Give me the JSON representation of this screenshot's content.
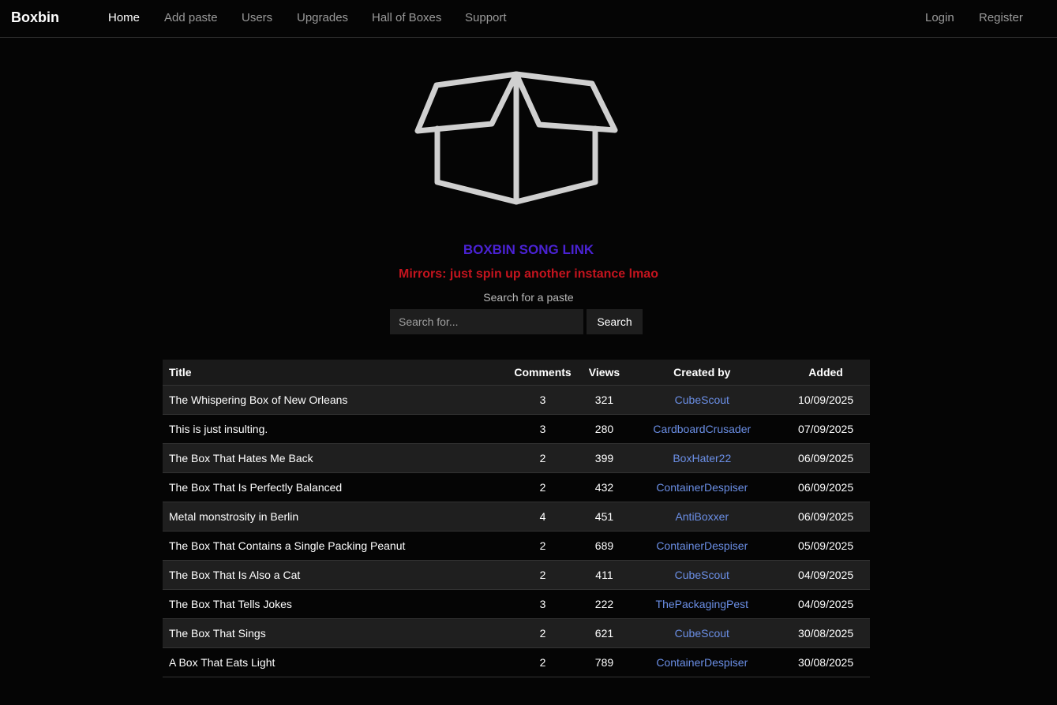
{
  "navbar": {
    "brand": "Boxbin",
    "links": [
      "Home",
      "Add paste",
      "Users",
      "Upgrades",
      "Hall of Boxes",
      "Support"
    ],
    "active": "Home",
    "login": "Login",
    "register": "Register"
  },
  "hero": {
    "logo_icon": "open-box-icon",
    "logo_color": "#d0d0d0",
    "song_link": "BOXBIN SONG LINK",
    "mirrors": "Mirrors: just spin up another instance lmao"
  },
  "search": {
    "label": "Search for a paste",
    "placeholder": "Search for...",
    "value": "",
    "button": "Search"
  },
  "table": {
    "headers": {
      "title": "Title",
      "comments": "Comments",
      "views": "Views",
      "created_by": "Created by",
      "added": "Added"
    },
    "rows": [
      {
        "title": "The Whispering Box of New Orleans",
        "comments": "3",
        "views": "321",
        "created_by": "CubeScout",
        "added": "10/09/2025"
      },
      {
        "title": "This is just insulting.",
        "comments": "3",
        "views": "280",
        "created_by": "CardboardCrusader",
        "added": "07/09/2025"
      },
      {
        "title": "The Box That Hates Me Back",
        "comments": "2",
        "views": "399",
        "created_by": "BoxHater22",
        "added": "06/09/2025"
      },
      {
        "title": "The Box That Is Perfectly Balanced",
        "comments": "2",
        "views": "432",
        "created_by": "ContainerDespiser",
        "added": "06/09/2025"
      },
      {
        "title": "Metal monstrosity in Berlin",
        "comments": "4",
        "views": "451",
        "created_by": "AntiBoxxer",
        "added": "06/09/2025"
      },
      {
        "title": "The Box That Contains a Single Packing Peanut",
        "comments": "2",
        "views": "689",
        "created_by": "ContainerDespiser",
        "added": "05/09/2025"
      },
      {
        "title": "The Box That Is Also a Cat",
        "comments": "2",
        "views": "411",
        "created_by": "CubeScout",
        "added": "04/09/2025"
      },
      {
        "title": "The Box That Tells Jokes",
        "comments": "3",
        "views": "222",
        "created_by": "ThePackagingPest",
        "added": "04/09/2025"
      },
      {
        "title": "The Box That Sings",
        "comments": "2",
        "views": "621",
        "created_by": "CubeScout",
        "added": "30/08/2025"
      },
      {
        "title": "A Box That Eats Light",
        "comments": "2",
        "views": "789",
        "created_by": "ContainerDespiser",
        "added": "30/08/2025"
      }
    ]
  },
  "colors": {
    "background": "#050505",
    "song_link": "#4a22d4",
    "mirrors": "#c4141e",
    "creator_link": "#6b8fe6",
    "row_alt": "#1f1f1f"
  }
}
